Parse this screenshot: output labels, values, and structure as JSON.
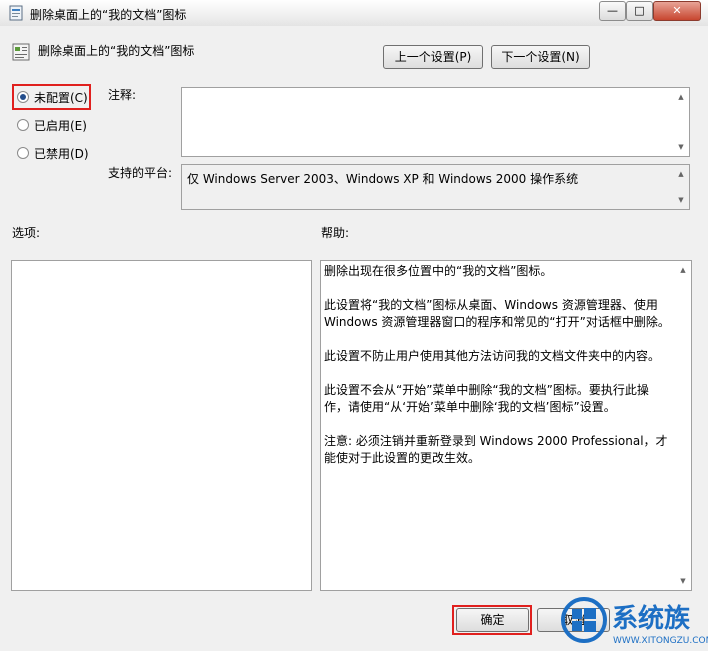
{
  "window": {
    "title": "删除桌面上的“我的文档”图标",
    "controls": {
      "minimize": "—",
      "maximize": "□",
      "close": "✕"
    }
  },
  "header": {
    "setting_title": "删除桌面上的“我的文档”图标",
    "prev_button": "上一个设置(P)",
    "next_button": "下一个设置(N)"
  },
  "state": {
    "options": [
      {
        "label": "未配置(C)",
        "checked": true
      },
      {
        "label": "已启用(E)",
        "checked": false
      },
      {
        "label": "已禁用(D)",
        "checked": false
      }
    ]
  },
  "comment": {
    "label": "注释:",
    "value": ""
  },
  "platform": {
    "label": "支持的平台:",
    "value": "仅 Windows Server 2003、Windows XP 和 Windows 2000 操作系统"
  },
  "options_section": {
    "label": "选项:"
  },
  "help_section": {
    "label": "帮助:",
    "paragraphs": [
      "删除出现在很多位置中的“我的文档”图标。",
      "此设置将“我的文档”图标从桌面、Windows 资源管理器、使用 Windows 资源管理器窗口的程序和常见的“打开”对话框中删除。",
      "此设置不防止用户使用其他方法访问我的文档文件夹中的内容。",
      "此设置不会从“开始”菜单中删除“我的文档”图标。要执行此操作，请使用“从‘开始’菜单中删除‘我的文档’图标”设置。",
      "注意: 必须注销并重新登录到 Windows 2000 Professional，才能使对于此设置的更改生效。"
    ]
  },
  "footer": {
    "ok_button": "确定",
    "cancel_button": "取消"
  },
  "watermark": {
    "text": "系统族",
    "url": "WWW.XITONGZU.COM"
  },
  "colors": {
    "highlight": "#e0201e",
    "watermark_blue": "#1d6fc4"
  }
}
